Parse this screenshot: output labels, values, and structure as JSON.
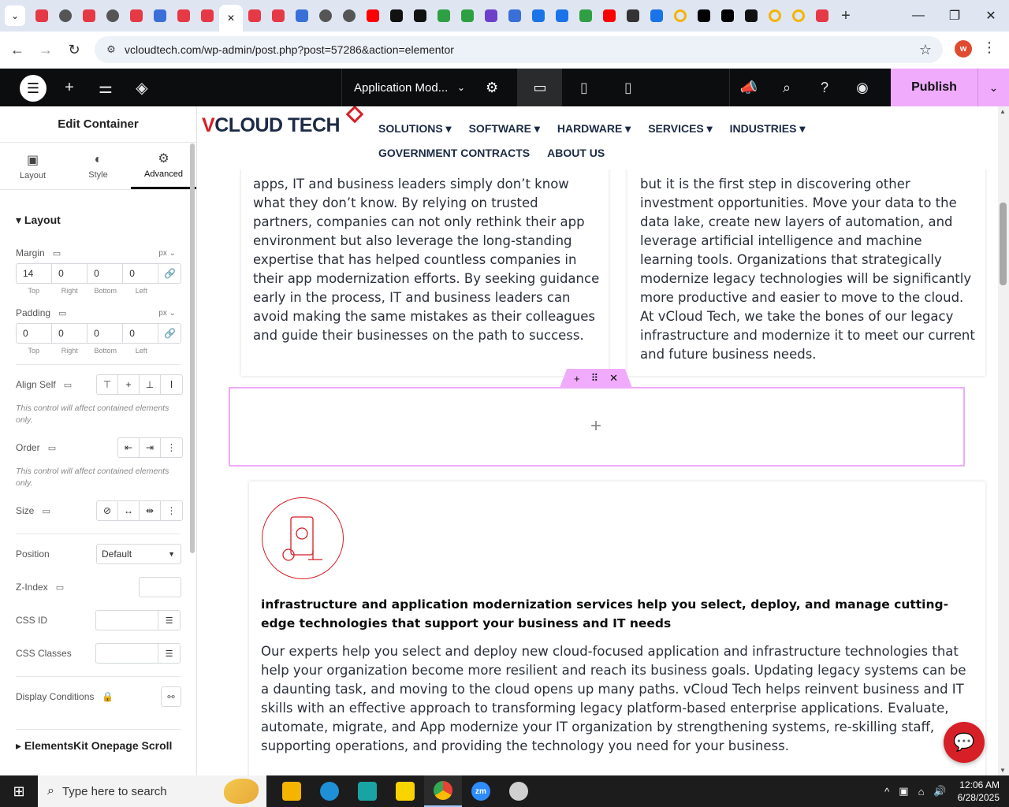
{
  "browser": {
    "url": "vcloudtech.com/wp-admin/post.php?post=57286&action=elementor",
    "profile_initial": "w",
    "tabs": [
      {
        "icon": "pinwheel-red",
        "color": "#e63946"
      },
      {
        "icon": "globe",
        "color": "#555555"
      },
      {
        "icon": "pinwheel-red",
        "color": "#e63946"
      },
      {
        "icon": "globe",
        "color": "#555555"
      },
      {
        "icon": "pinwheel-red",
        "color": "#e63946"
      },
      {
        "icon": "app-blue",
        "color": "#3b6fd8"
      },
      {
        "icon": "pinwheel-red",
        "color": "#e63946"
      },
      {
        "icon": "pinwheel-red",
        "color": "#e63946"
      },
      {
        "icon": "active",
        "color": "#ffffff"
      },
      {
        "icon": "pinwheel-red",
        "color": "#e63946"
      },
      {
        "icon": "pinwheel-red",
        "color": "#e63946"
      },
      {
        "icon": "app-blue",
        "color": "#3b6fd8"
      },
      {
        "icon": "globe",
        "color": "#555555"
      },
      {
        "icon": "globe",
        "color": "#555555"
      },
      {
        "icon": "youtube",
        "color": "#ff0000"
      },
      {
        "icon": "openai",
        "color": "#111111"
      },
      {
        "icon": "openai",
        "color": "#111111"
      },
      {
        "icon": "green-app",
        "color": "#2ea043"
      },
      {
        "icon": "green-app",
        "color": "#2ea043"
      },
      {
        "icon": "purple-app",
        "color": "#6e40c9"
      },
      {
        "icon": "app-blue",
        "color": "#3b6fd8"
      },
      {
        "icon": "dots-blue",
        "color": "#1a73e8"
      },
      {
        "icon": "dots-blue",
        "color": "#1a73e8"
      },
      {
        "icon": "green-app",
        "color": "#2ea043"
      },
      {
        "icon": "youtube",
        "color": "#ff0000"
      },
      {
        "icon": "hat",
        "color": "#333333"
      },
      {
        "icon": "arc-blue",
        "color": "#1a73e8"
      },
      {
        "icon": "ring",
        "color": "#f4b400"
      },
      {
        "icon": "x",
        "color": "#000000"
      },
      {
        "icon": "x",
        "color": "#000000"
      },
      {
        "icon": "n-logo",
        "color": "#111111"
      },
      {
        "icon": "ring",
        "color": "#f4b400"
      },
      {
        "icon": "ring",
        "color": "#f4b400"
      },
      {
        "icon": "slash-red",
        "color": "#e63946"
      }
    ]
  },
  "editor": {
    "page_title": "Application Mod...",
    "publish_label": "Publish"
  },
  "panel": {
    "title": "Edit Container",
    "tabs": [
      {
        "label": "Layout",
        "icon": "layout-icon"
      },
      {
        "label": "Style",
        "icon": "style-icon"
      },
      {
        "label": "Advanced",
        "icon": "gear-icon"
      }
    ],
    "section_title": "Layout",
    "margin": {
      "label": "Margin",
      "unit": "px",
      "top": "14",
      "right": "0",
      "bottom": "0",
      "left": "0"
    },
    "padding": {
      "label": "Padding",
      "unit": "px",
      "top": "0",
      "right": "0",
      "bottom": "0",
      "left": "0"
    },
    "dim_labels": {
      "top": "Top",
      "right": "Right",
      "bottom": "Bottom",
      "left": "Left"
    },
    "align_self_label": "Align Self",
    "note": "This control will affect contained elements only.",
    "order_label": "Order",
    "size_label": "Size",
    "position_label": "Position",
    "position_value": "Default",
    "zindex_label": "Z-Index",
    "cssid_label": "CSS ID",
    "cssclasses_label": "CSS Classes",
    "display_conditions_label": "Display Conditions",
    "next_section": "ElementsKit Onepage Scroll"
  },
  "site": {
    "logo_v": "V",
    "logo_rest": "CLOUD TECH",
    "nav": [
      "SOLUTIONS ▾",
      "SOFTWARE ▾",
      "HARDWARE ▾",
      "SERVICES ▾",
      "INDUSTRIES ▾",
      "GOVERNMENT CONTRACTS",
      "ABOUT US"
    ],
    "left_para": "apps, IT and business leaders simply don’t know what they don’t know. By relying on trusted partners, companies can not only rethink their app environment but also leverage the long-standing expertise that has helped countless companies in their app modernization efforts. By seeking guidance early in the process, IT and business leaders can avoid making the same mistakes as their colleagues and guide their businesses on the path to success.",
    "right_para": "but it is the first step in discovering other investment opportunities. Move your data to the data lake, create new layers of automation, and leverage artificial intelligence and machine learning tools. Organizations that strategically modernize legacy technologies will be significantly more productive and easier to move to the cloud. At vCloud Tech, we take the bones of our legacy infrastructure and modernize it to meet our current and future business needs.",
    "bold_heading": "infrastructure and application modernization services help you select, deploy, and manage cutting-edge technologies that support your business and IT needs",
    "body_para": "Our experts help you select and deploy new cloud-focused application and infrastructure technologies that help your organization become more resilient and reach its business goals. Updating legacy systems can be a daunting task, and moving to the cloud opens up many paths. vCloud Tech helps reinvent business and IT skills with an effective approach to transforming legacy platform-based enterprise applications. Evaluate, automate, migrate, and App modernize your IT organization by strengthening systems, re-skilling staff, supporting operations, and providing the technology you need for your business.",
    "accent_color": "#d61f26",
    "navy_color": "#1b2a45"
  },
  "taskbar": {
    "search_placeholder": "Type here to search",
    "time": "12:06 AM",
    "date": "6/28/2025"
  }
}
